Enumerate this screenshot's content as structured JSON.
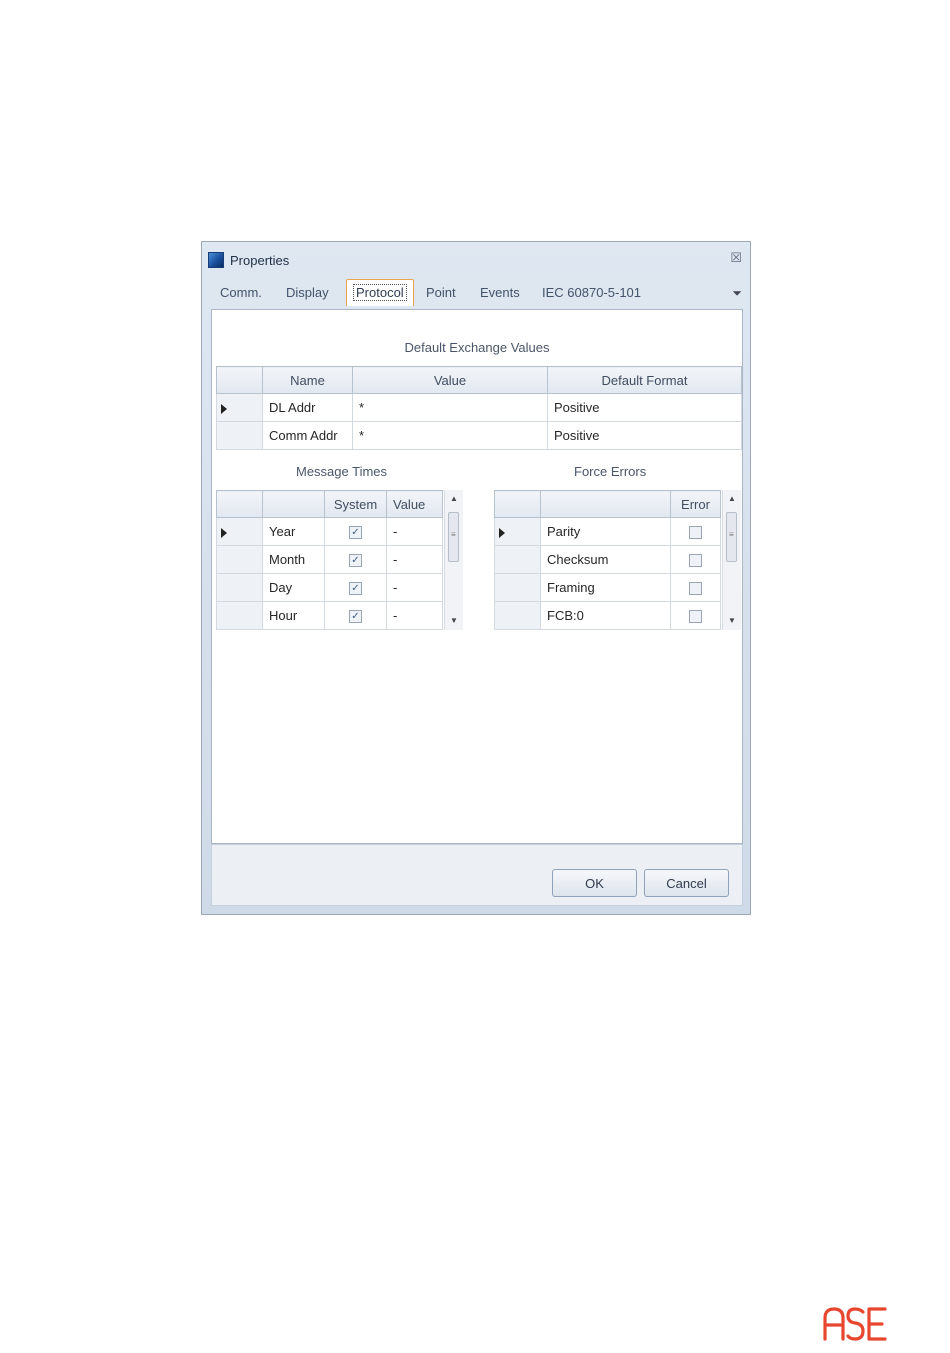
{
  "dialog": {
    "title": "Properties",
    "close_glyph": "☒",
    "tabs": [
      "Comm.",
      "Display",
      "Protocol",
      "Point",
      "Events",
      "IEC 60870-5-101"
    ],
    "active_tab": "Protocol",
    "overflow_glyph": "⏷"
  },
  "exchange": {
    "label": "Default Exchange Values",
    "columns": [
      "Name",
      "Value",
      "Default Format"
    ],
    "rows": [
      {
        "name": "DL Addr",
        "value": "*",
        "format": "Positive"
      },
      {
        "name": "Comm Addr",
        "value": "*",
        "format": "Positive"
      }
    ]
  },
  "message_times": {
    "label": "Message Times",
    "columns": [
      "System",
      "Value"
    ],
    "rows": [
      {
        "name": "Year",
        "system": true,
        "value": "-"
      },
      {
        "name": "Month",
        "system": true,
        "value": "-"
      },
      {
        "name": "Day",
        "system": true,
        "value": "-"
      },
      {
        "name": "Hour",
        "system": true,
        "value": "-"
      }
    ]
  },
  "force_errors": {
    "label": "Force Errors",
    "columns": [
      "Error"
    ],
    "rows": [
      {
        "name": "Parity",
        "error": false
      },
      {
        "name": "Checksum",
        "error": false
      },
      {
        "name": "Framing",
        "error": false
      },
      {
        "name": "FCB:0",
        "error": false
      }
    ]
  },
  "buttons": {
    "ok": "OK",
    "cancel": "Cancel"
  },
  "brand": {
    "logo_text": "ASE",
    "color": "#e8462f"
  }
}
